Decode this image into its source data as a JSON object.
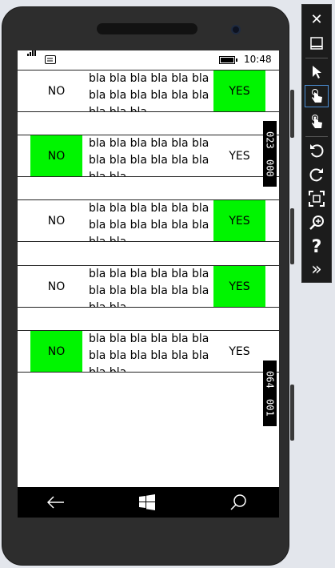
{
  "status_bar": {
    "time": "10:48"
  },
  "rows": [
    {
      "no": "NO",
      "yes": "YES",
      "text": "bla bla bla bla bla bla bla bla bla bla bla bla bla bla bla",
      "highlight": "yes"
    },
    {
      "no": "NO",
      "yes": "YES",
      "text": "bla bla bla bla bla bla bla bla bla bla bla bla bla bla",
      "highlight": "no"
    },
    {
      "no": "NO",
      "yes": "YES",
      "text": "bla bla bla bla bla bla bla bla bla bla bla bla bla bla",
      "highlight": "yes"
    },
    {
      "no": "NO",
      "yes": "YES",
      "text": "bla bla bla bla bla bla bla bla bla bla bla bla bla bla",
      "highlight": "yes"
    },
    {
      "no": "NO",
      "yes": "YES",
      "text": "bla bla bla bla bla bla bla bla bla bla bla bla bla bla",
      "highlight": "no"
    }
  ],
  "counters": [
    {
      "a": "023",
      "b": "000"
    },
    {
      "a": "064",
      "b": "001"
    }
  ],
  "nav": {
    "back": "back-arrow-icon",
    "start": "windows-logo-icon",
    "search": "search-icon"
  },
  "toolbar": {
    "items": [
      "close-icon",
      "minimize-icon",
      "pointer-icon",
      "single-touch-icon",
      "multi-touch-icon",
      "rotate-left-icon",
      "rotate-right-icon",
      "fit-to-screen-icon",
      "zoom-icon",
      "help-icon",
      "tools-expand-icon"
    ],
    "help_glyph": "?",
    "close_glyph": "✕",
    "expand_glyph": "»"
  },
  "colors": {
    "highlight": "#00f500",
    "toolbar": "#1c1c1c",
    "selected_border": "#4b8fd6"
  }
}
